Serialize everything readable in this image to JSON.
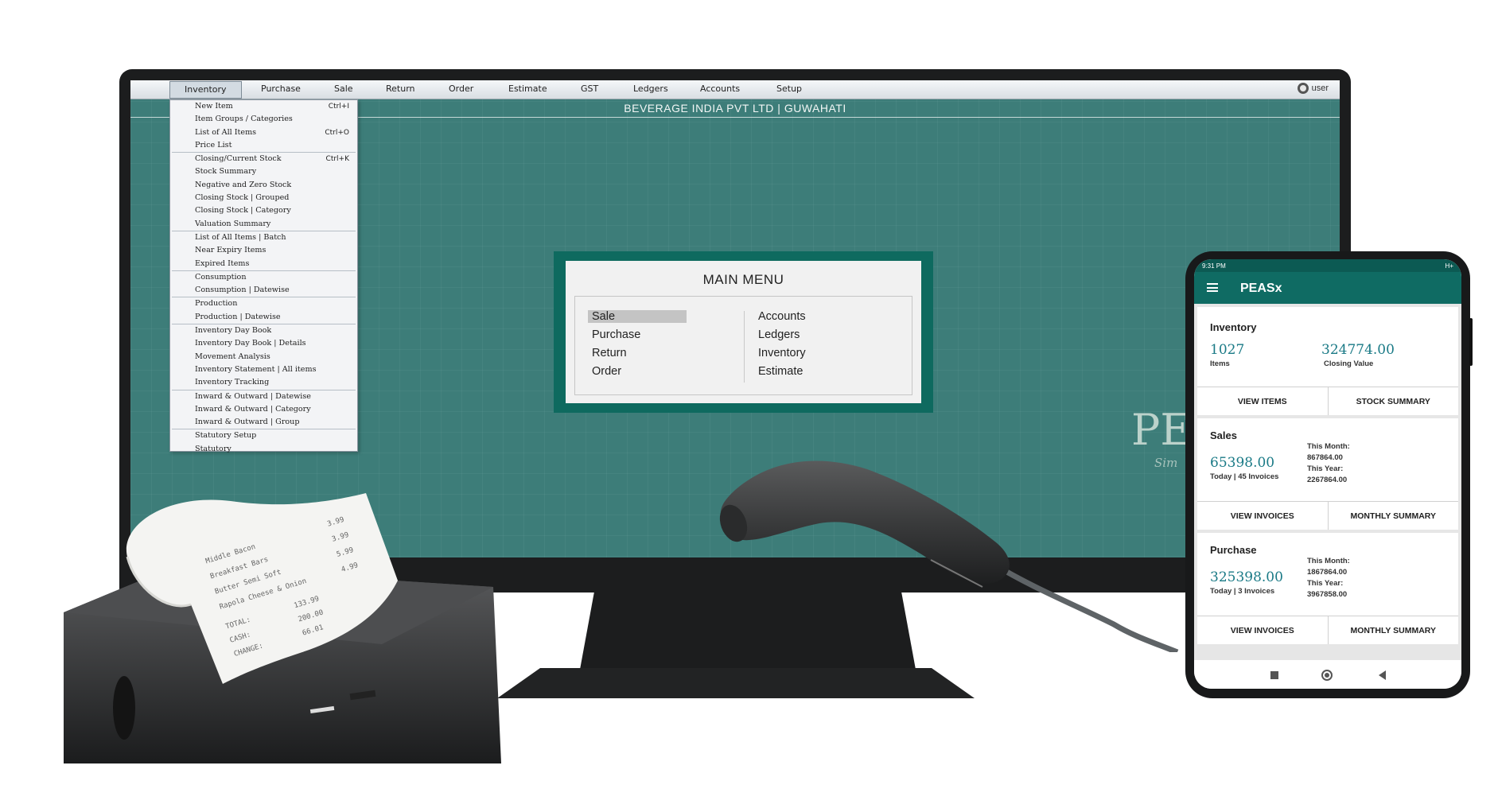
{
  "menubar": {
    "items": [
      "Inventory",
      "Purchase",
      "Sale",
      "Return",
      "Order",
      "Estimate",
      "GST",
      "Ledgers",
      "Accounts",
      "Setup"
    ],
    "user_label": "user"
  },
  "company_title": "BEVERAGE INDIA PVT LTD | GUWAHATI",
  "dropdown": [
    {
      "label": "New Item",
      "shortcut": "Ctrl+I"
    },
    {
      "label": "Item Groups / Categories"
    },
    {
      "label": "List of All Items",
      "shortcut": "Ctrl+O"
    },
    {
      "label": "Price List"
    },
    {
      "label": "Closing/Current Stock",
      "shortcut": "Ctrl+K"
    },
    {
      "label": "Stock Summary"
    },
    {
      "label": "Negative and Zero Stock"
    },
    {
      "label": "Closing Stock | Grouped"
    },
    {
      "label": "Closing Stock | Category"
    },
    {
      "label": "Valuation Summary"
    },
    {
      "label": "List of All Items | Batch"
    },
    {
      "label": "Near Expiry Items"
    },
    {
      "label": "Expired Items"
    },
    {
      "label": "Consumption"
    },
    {
      "label": "Consumption | Datewise"
    },
    {
      "label": "Production"
    },
    {
      "label": "Production | Datewise"
    },
    {
      "label": "Inventory Day Book"
    },
    {
      "label": "Inventory Day Book | Details"
    },
    {
      "label": "Movement Analysis"
    },
    {
      "label": "Inventory Statement | All items"
    },
    {
      "label": "Inventory Tracking"
    },
    {
      "label": "Inward & Outward | Datewise"
    },
    {
      "label": "Inward & Outward | Category"
    },
    {
      "label": "Inward & Outward | Group"
    },
    {
      "label": "Statutory Setup"
    },
    {
      "label": "Statutory"
    }
  ],
  "main_menu": {
    "title": "MAIN MENU",
    "left": [
      "Sale",
      "Purchase",
      "Return",
      "Order"
    ],
    "right": [
      "Accounts",
      "Ledgers",
      "Inventory",
      "Estimate"
    ],
    "selected": "Sale"
  },
  "logo": {
    "text": "PE",
    "tagline": "Sim"
  },
  "phone": {
    "time": "9:31 PM",
    "status_right": "H+",
    "app_title": "PEASx",
    "inventory": {
      "title": "Inventory",
      "items_value": "1027",
      "items_label": "Items",
      "closing_value": "324774.00",
      "closing_label": "Closing Value",
      "btn_left": "VIEW ITEMS",
      "btn_right": "STOCK SUMMARY"
    },
    "sales": {
      "title": "Sales",
      "today_value": "65398.00",
      "today_label": "Today | 45 Invoices",
      "month_label": "This Month:",
      "month_value": "867864.00",
      "year_label": "This Year:",
      "year_value": "2267864.00",
      "btn_left": "VIEW INVOICES",
      "btn_right": "MONTHLY SUMMARY"
    },
    "purchase": {
      "title": "Purchase",
      "today_value": "325398.00",
      "today_label": "Today | 3 Invoices",
      "month_label": "This Month:",
      "month_value": "1867864.00",
      "year_label": "This Year:",
      "year_value": "3967858.00",
      "btn_left": "VIEW INVOICES",
      "btn_right": "MONTHLY SUMMARY"
    }
  },
  "receipt_lines": [
    "Middle Bacon",
    "3.99",
    "Breakfast Bars",
    "3.99",
    "Butter Semi Soft",
    "5.99",
    "Rapola Cheese & Onion",
    "4.99",
    "TOTAL:",
    "133.99",
    "CASH:",
    "200.00",
    "CHANGE:",
    "66.01"
  ]
}
